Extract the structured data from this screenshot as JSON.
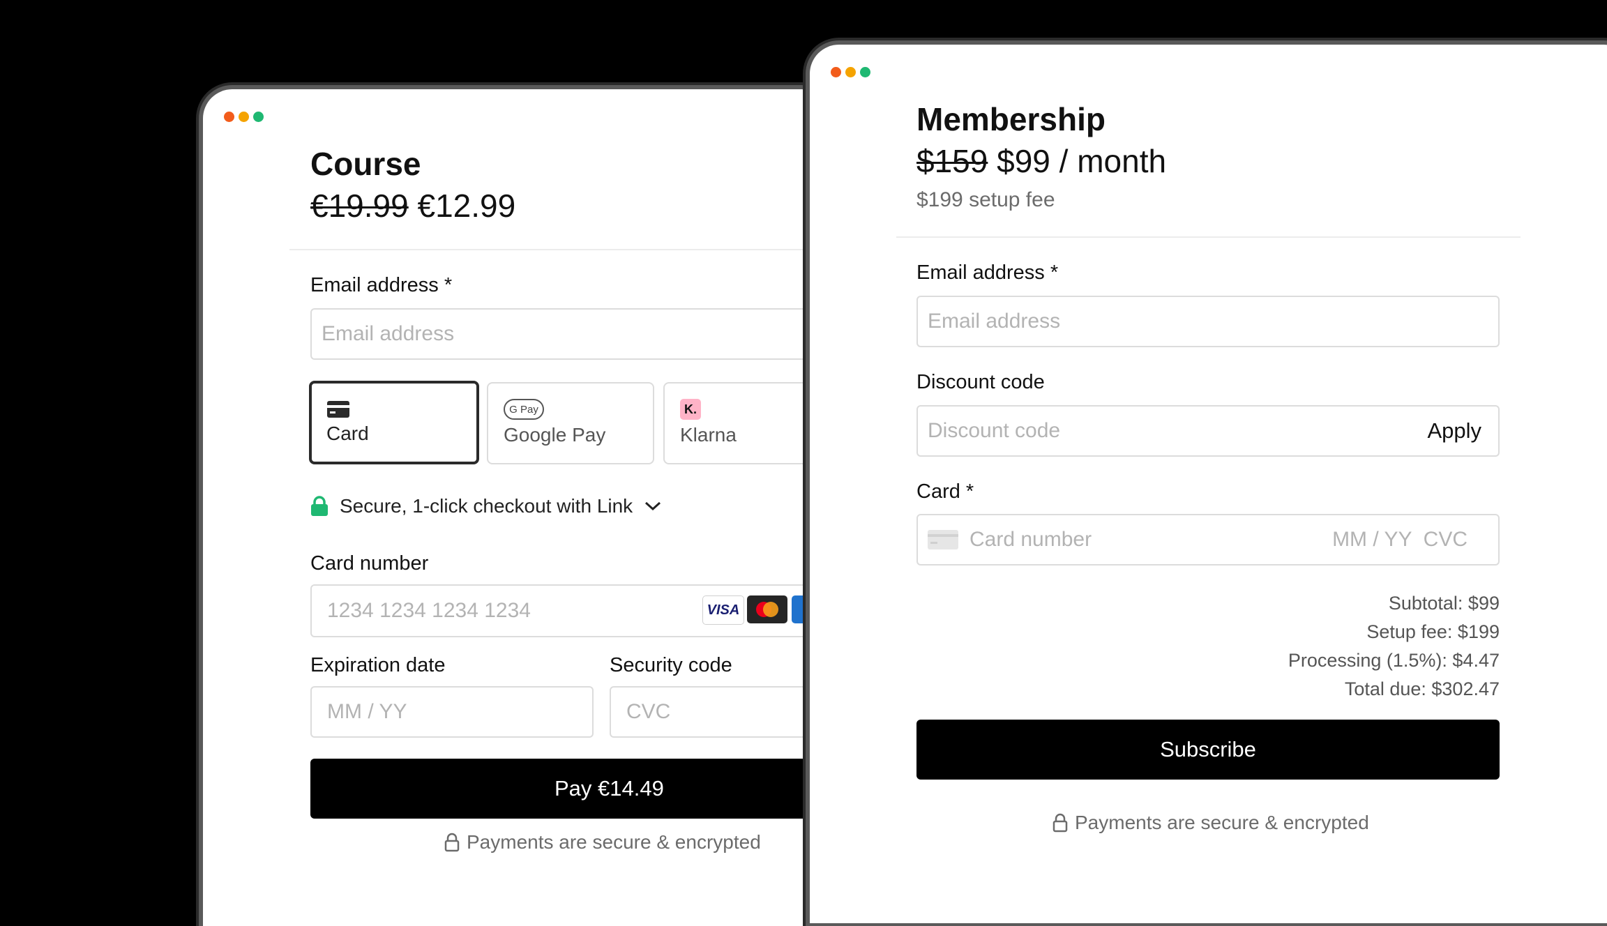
{
  "window_controls": {
    "colors": [
      "#f25c1b",
      "#f5a300",
      "#1fb872"
    ]
  },
  "course": {
    "title": "Course",
    "price_old": "€19.99",
    "price_new": "€12.99",
    "email_label": "Email address",
    "required_mark": "*",
    "email_placeholder": "Email address",
    "payment_methods": [
      {
        "label": "Card",
        "icon": "card-icon",
        "selected": true
      },
      {
        "label": "Google Pay",
        "icon": "google-pay-icon",
        "selected": false
      },
      {
        "label": "Klarna",
        "icon": "klarna-icon",
        "selected": false
      }
    ],
    "gpay_badge": "G Pay",
    "klarna_badge": "K.",
    "link_text": "Secure, 1-click checkout with Link",
    "card_number_label": "Card number",
    "card_number_placeholder": "1234 1234 1234 1234",
    "brand_visa": "VISA",
    "expiration_label": "Expiration date",
    "expiration_placeholder": "MM / YY",
    "security_label": "Security code",
    "security_placeholder": "CVC",
    "pay_button": "Pay €14.49",
    "secure_note": "Payments are secure & encrypted"
  },
  "membership": {
    "title": "Membership",
    "price_old": "$159",
    "price_new": "$99 / month",
    "setup_fee_note": "$199 setup fee",
    "email_label": "Email address",
    "required_mark": "*",
    "email_placeholder": "Email address",
    "discount_label": "Discount code",
    "discount_placeholder": "Discount code",
    "apply_button": "Apply",
    "card_label": "Card",
    "card_number_placeholder": "Card number",
    "card_expiry_cvc_placeholder": "MM / YY  CVC",
    "summary": {
      "subtotal": "Subtotal: $99",
      "setup_fee": "Setup fee: $199",
      "processing": "Processing (1.5%): $4.47",
      "total": "Total due: $302.47"
    },
    "subscribe_button": "Subscribe",
    "secure_note": "Payments are secure & encrypted"
  },
  "colors": {
    "accent_green": "#1fb872",
    "klarna_pink": "#ffb3c7",
    "mastercard_red": "#eb001b",
    "mastercard_orange": "#f79e1b",
    "amex_blue": "#1f72cd"
  }
}
